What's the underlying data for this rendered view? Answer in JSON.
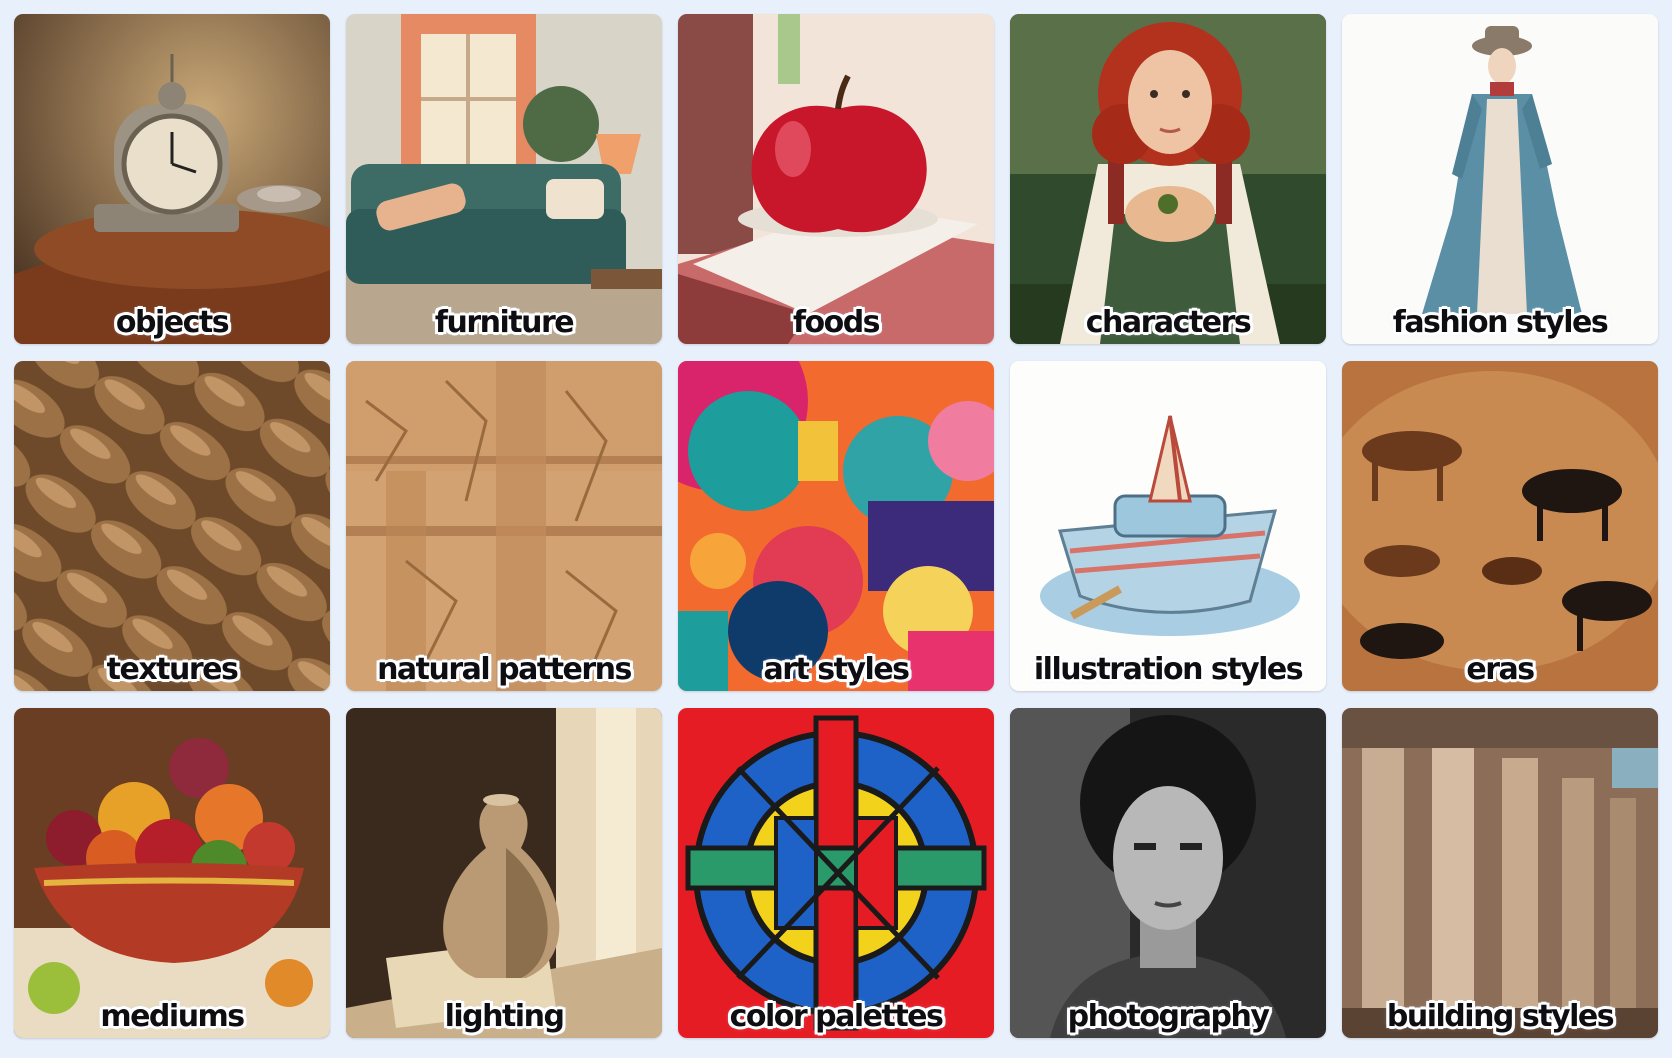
{
  "tiles": [
    {
      "label": "objects",
      "icon": "alarm-clock-image"
    },
    {
      "label": "furniture",
      "icon": "sofa-image"
    },
    {
      "label": "foods",
      "icon": "apple-image"
    },
    {
      "label": "characters",
      "icon": "red-haired-girl-image"
    },
    {
      "label": "fashion styles",
      "icon": "victorian-coat-woman-image"
    },
    {
      "label": "textures",
      "icon": "knit-rope-image"
    },
    {
      "label": "natural patterns",
      "icon": "cracked-earth-image"
    },
    {
      "label": "art styles",
      "icon": "abstract-shapes-image"
    },
    {
      "label": "illustration styles",
      "icon": "toy-boat-image"
    },
    {
      "label": "eras",
      "icon": "cave-painting-image"
    },
    {
      "label": "mediums",
      "icon": "fruit-bowl-painting-image"
    },
    {
      "label": "lighting",
      "icon": "vase-sunlight-image"
    },
    {
      "label": "color palettes",
      "icon": "stained-glass-image"
    },
    {
      "label": "photography",
      "icon": "portrait-photo-image"
    },
    {
      "label": "building styles",
      "icon": "greek-columns-image"
    }
  ]
}
